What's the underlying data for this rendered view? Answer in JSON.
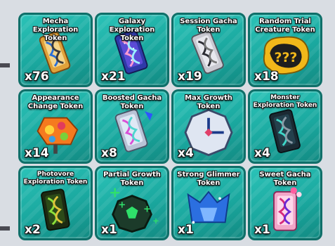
{
  "inventory": {
    "tokens": [
      {
        "name": "Mecha Exploration Token",
        "count": "x76",
        "icon": "mecha-exploration-token-icon"
      },
      {
        "name": "Galaxy Exploration Token",
        "count": "x21",
        "icon": "galaxy-exploration-token-icon"
      },
      {
        "name": "Session Gacha Token",
        "count": "x19",
        "icon": "session-gacha-token-icon"
      },
      {
        "name": "Random Trial Creature Token",
        "count": "x18",
        "icon": "random-trial-creature-token-icon"
      },
      {
        "name": "Appearance Change Token",
        "count": "x14",
        "icon": "appearance-change-token-icon"
      },
      {
        "name": "Boosted Gacha Token",
        "count": "x8",
        "icon": "boosted-gacha-token-icon"
      },
      {
        "name": "Max Growth Token",
        "count": "x4",
        "icon": "max-growth-token-icon"
      },
      {
        "name": "Monster Exploration Token",
        "count": "x4",
        "icon": "monster-exploration-token-icon"
      },
      {
        "name": "Photovore Exploration Token",
        "count": "x2",
        "icon": "photovore-exploration-token-icon"
      },
      {
        "name": "Partial Growth Token",
        "count": "x1",
        "icon": "partial-growth-token-icon"
      },
      {
        "name": "Strong Glimmer Token",
        "count": "x1",
        "icon": "strong-glimmer-token-icon"
      },
      {
        "name": "Sweet Gacha Token",
        "count": "x1",
        "icon": "sweet-gacha-token-icon"
      }
    ]
  },
  "colors": {
    "tile_bg": "#1fb3a9",
    "tile_border": "#0f6f69",
    "page_bg": "#d9dde3"
  }
}
